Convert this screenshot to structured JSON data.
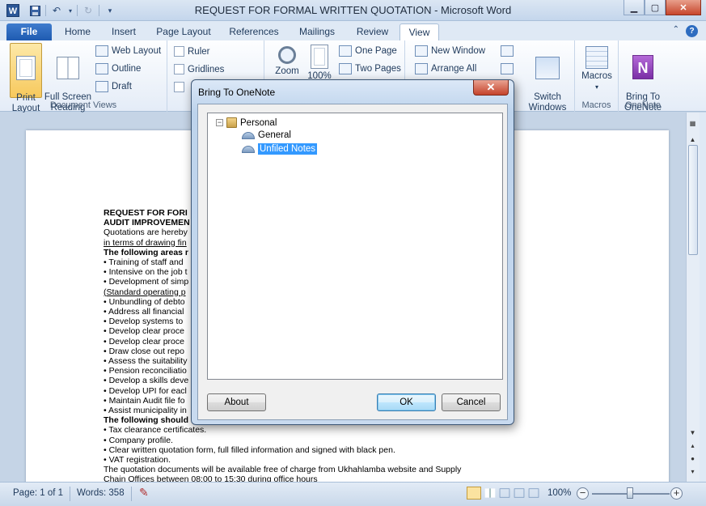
{
  "window": {
    "title": "REQUEST FOR FORMAL WRITTEN QUOTATION  -  Microsoft Word",
    "app_logo": "W"
  },
  "tabs": [
    {
      "label": "File"
    },
    {
      "label": "Home"
    },
    {
      "label": "Insert"
    },
    {
      "label": "Page Layout"
    },
    {
      "label": "References"
    },
    {
      "label": "Mailings"
    },
    {
      "label": "Review"
    },
    {
      "label": "View"
    }
  ],
  "ribbon": {
    "document_views": {
      "label": "Document Views",
      "print_layout": "Print\nLayout",
      "full_screen_reading": "Full Screen\nReading",
      "web_layout": "Web Layout",
      "outline": "Outline",
      "draft": "Draft"
    },
    "show": {
      "ruler": "Ruler",
      "gridlines": "Gridlines"
    },
    "zoom": {
      "zoom": "Zoom",
      "percent": "100%",
      "one_page": "One Page",
      "two_pages": "Two Pages"
    },
    "window": {
      "new_window": "New Window",
      "arrange_all": "Arrange All",
      "switch_windows": "Switch\nWindows"
    },
    "macros": {
      "label": "Macros",
      "button": "Macros"
    },
    "onenote": {
      "label": "OneNote",
      "button": "Bring To\nOneNote"
    }
  },
  "document": {
    "lines": [
      {
        "text": "REQUEST FOR FORI",
        "style": "b"
      },
      {
        "text": "AUDIT IMPROVEMEN",
        "style": "b"
      },
      {
        "text": "Quotations are hereby",
        "style": ""
      },
      {
        "text": "in terms of drawing fin",
        "style": "u"
      },
      {
        "text": "The following areas r",
        "style": "b"
      },
      {
        "text": "• Training of staff and",
        "style": ""
      },
      {
        "text": "• Intensive on the job t",
        "style": ""
      },
      {
        "text": "• Development of simp",
        "style": ""
      },
      {
        "text": "(Standard operating p",
        "style": "u"
      },
      {
        "text": "• Unbundling of debto",
        "style": ""
      },
      {
        "text": "• Address all financial",
        "style": ""
      },
      {
        "text": "• Develop systems to",
        "style": ""
      },
      {
        "text": "• Develop clear proce",
        "style": ""
      },
      {
        "text": "• Develop clear proce",
        "style": ""
      },
      {
        "text": "• Draw close out repo",
        "style": ""
      },
      {
        "text": "• Assess the suitability",
        "style": ""
      },
      {
        "text": "• Pension reconciliatio",
        "style": ""
      },
      {
        "text": "• Develop a skills deve",
        "style": ""
      },
      {
        "text": "• Develop UPI for eacl",
        "style": ""
      },
      {
        "text": "• Maintain Audit file fo",
        "style": ""
      },
      {
        "text": "• Assist municipality in",
        "style": ""
      },
      {
        "text": "The following should",
        "style": "b"
      },
      {
        "text": "• Tax clearance certificates.",
        "style": ""
      },
      {
        "text": "• Company profile.",
        "style": ""
      },
      {
        "text": "• Clear written quotation form, full filled information and signed with black pen.",
        "style": ""
      },
      {
        "text": "• VAT registration.",
        "style": ""
      },
      {
        "text": "The quotation documents will be available free of charge from Ukhahlamba website and Supply",
        "style": ""
      },
      {
        "text": "Chain Offices between 08:00 to 15:30 during office hours",
        "style": ""
      }
    ]
  },
  "statusbar": {
    "page": "Page: 1 of 1",
    "words": "Words: 358",
    "zoom": "100%",
    "zoom_level": 1.0
  },
  "dialog": {
    "title": "Bring To OneNote",
    "close_glyph": "✕",
    "tree": {
      "notebook": "Personal",
      "sections": [
        "General",
        "Unfiled Notes"
      ],
      "selected": "Unfiled Notes"
    },
    "buttons": {
      "about": "About",
      "ok": "OK",
      "cancel": "Cancel"
    }
  },
  "colors": {
    "accent": "#2b5797",
    "selection": "#3399ff",
    "file_tab": "#2d6cc0",
    "onenote": "#7b2fa6"
  }
}
